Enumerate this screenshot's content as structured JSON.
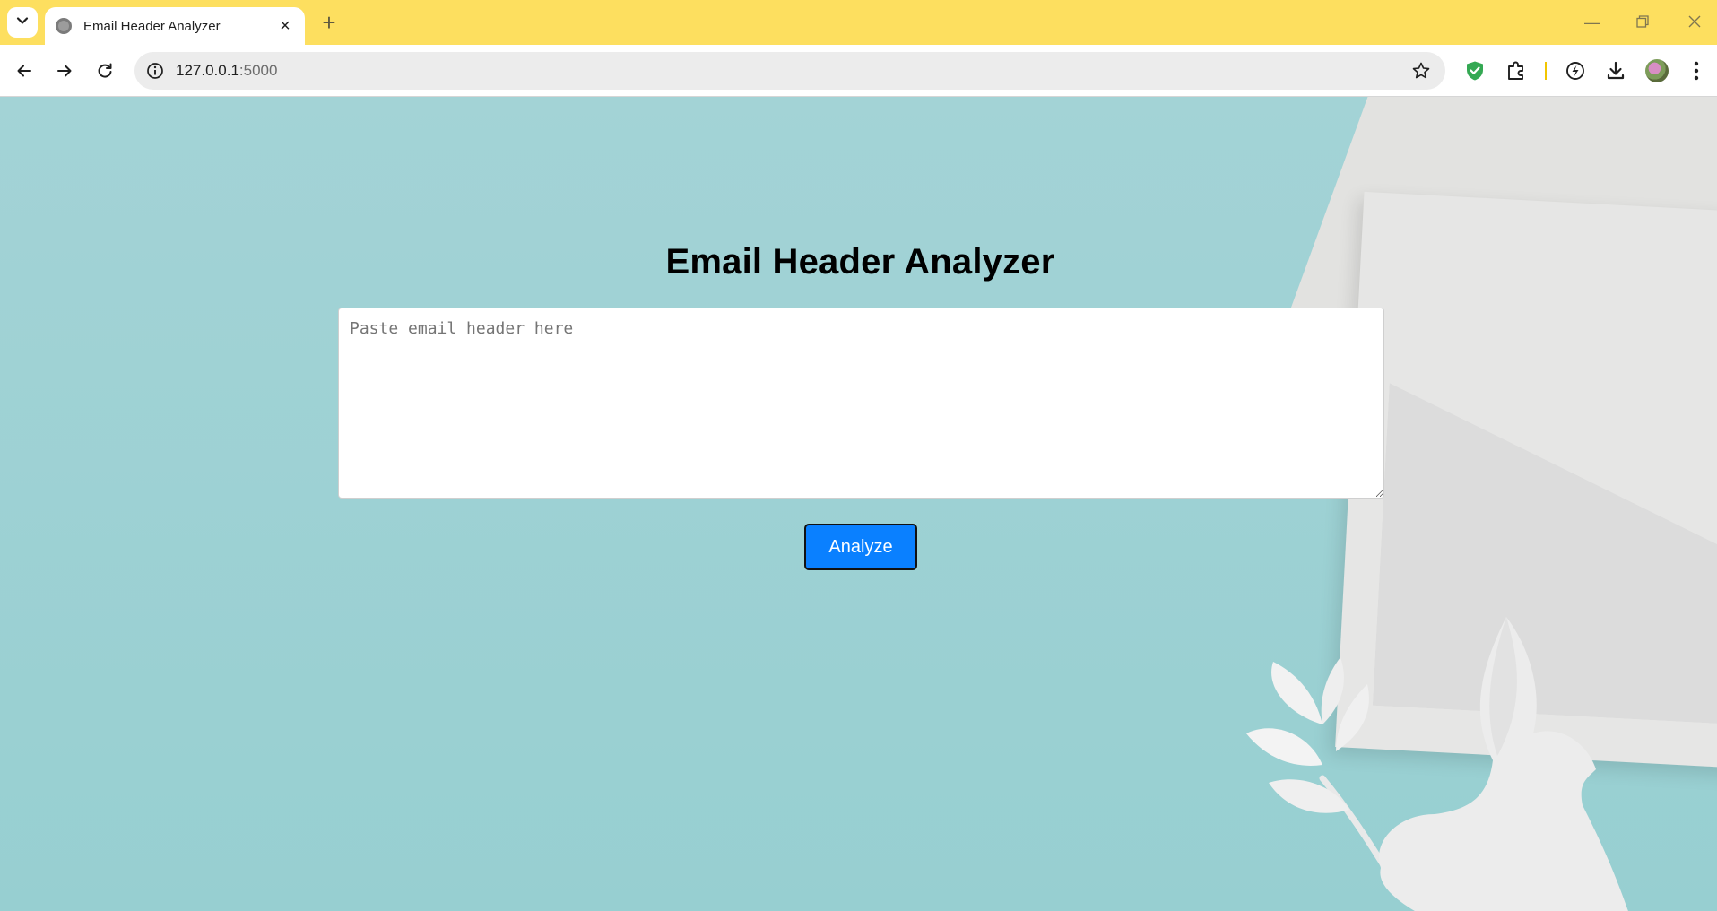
{
  "browser": {
    "tab_title": "Email Header Analyzer",
    "url_host": "127.0.0.1",
    "url_port": ":5000",
    "accent": "#fddf5f"
  },
  "page": {
    "title": "Email Header Analyzer",
    "input_placeholder": "Paste email header here",
    "input_value": "",
    "analyze_label": "Analyze",
    "button_color": "#0a80ff",
    "background_color": "#9fd0d2"
  }
}
